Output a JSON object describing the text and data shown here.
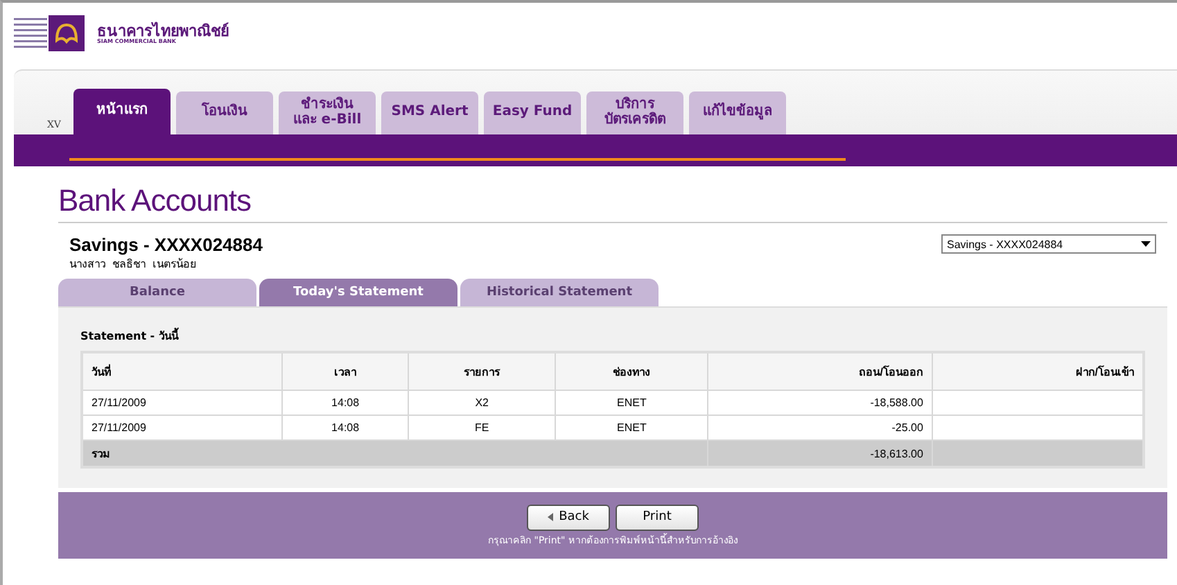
{
  "logo": {
    "name": "ธนาคารไทยพาณิชย์",
    "subtitle": "SIAM COMMERCIAL BANK"
  },
  "nav": {
    "marker": "XV",
    "tabs": [
      {
        "label": "หน้าแรก",
        "selected": true
      },
      {
        "label": "โอนเงิน",
        "selected": false
      },
      {
        "label": "ชำระเงิน\nและ e-Bill",
        "selected": false
      },
      {
        "label": "SMS Alert",
        "selected": false
      },
      {
        "label": "Easy Fund",
        "selected": false
      },
      {
        "label": "บริการ\nบัตรเครดิต",
        "selected": false
      },
      {
        "label": "แก้ไขข้อมูล",
        "selected": false
      }
    ]
  },
  "title": "Bank Accounts",
  "account": {
    "name": "Savings - XXXX024884",
    "holder": "นางสาว  ชลธิชา  เนตรน้อย",
    "select_value": "Savings - XXXX024884"
  },
  "sub_tabs": [
    {
      "label": "Balance",
      "selected": false
    },
    {
      "label": "Today's Statement",
      "selected": true
    },
    {
      "label": "Historical Statement",
      "selected": false
    }
  ],
  "statement": {
    "heading": "Statement - วันนี้",
    "columns": [
      "วันที่",
      "เวลา",
      "รายการ",
      "ช่องทาง",
      "ถอน/โอนออก",
      "ฝาก/โอนเข้า"
    ],
    "rows": [
      [
        "27/11/2009",
        "14:08",
        "X2",
        "ENET",
        "-18,588.00",
        ""
      ],
      [
        "27/11/2009",
        "14:08",
        "FE",
        "ENET",
        "-25.00",
        ""
      ]
    ],
    "total": {
      "label": "รวม",
      "withdrawal": "-18,613.00"
    }
  },
  "buttons": {
    "back": "Back",
    "print": "Print"
  },
  "note": "กรุณาคลิก \"Print\" หากต้องการพิมพ์หน้านี้สำหรับการอ้างอิง"
}
